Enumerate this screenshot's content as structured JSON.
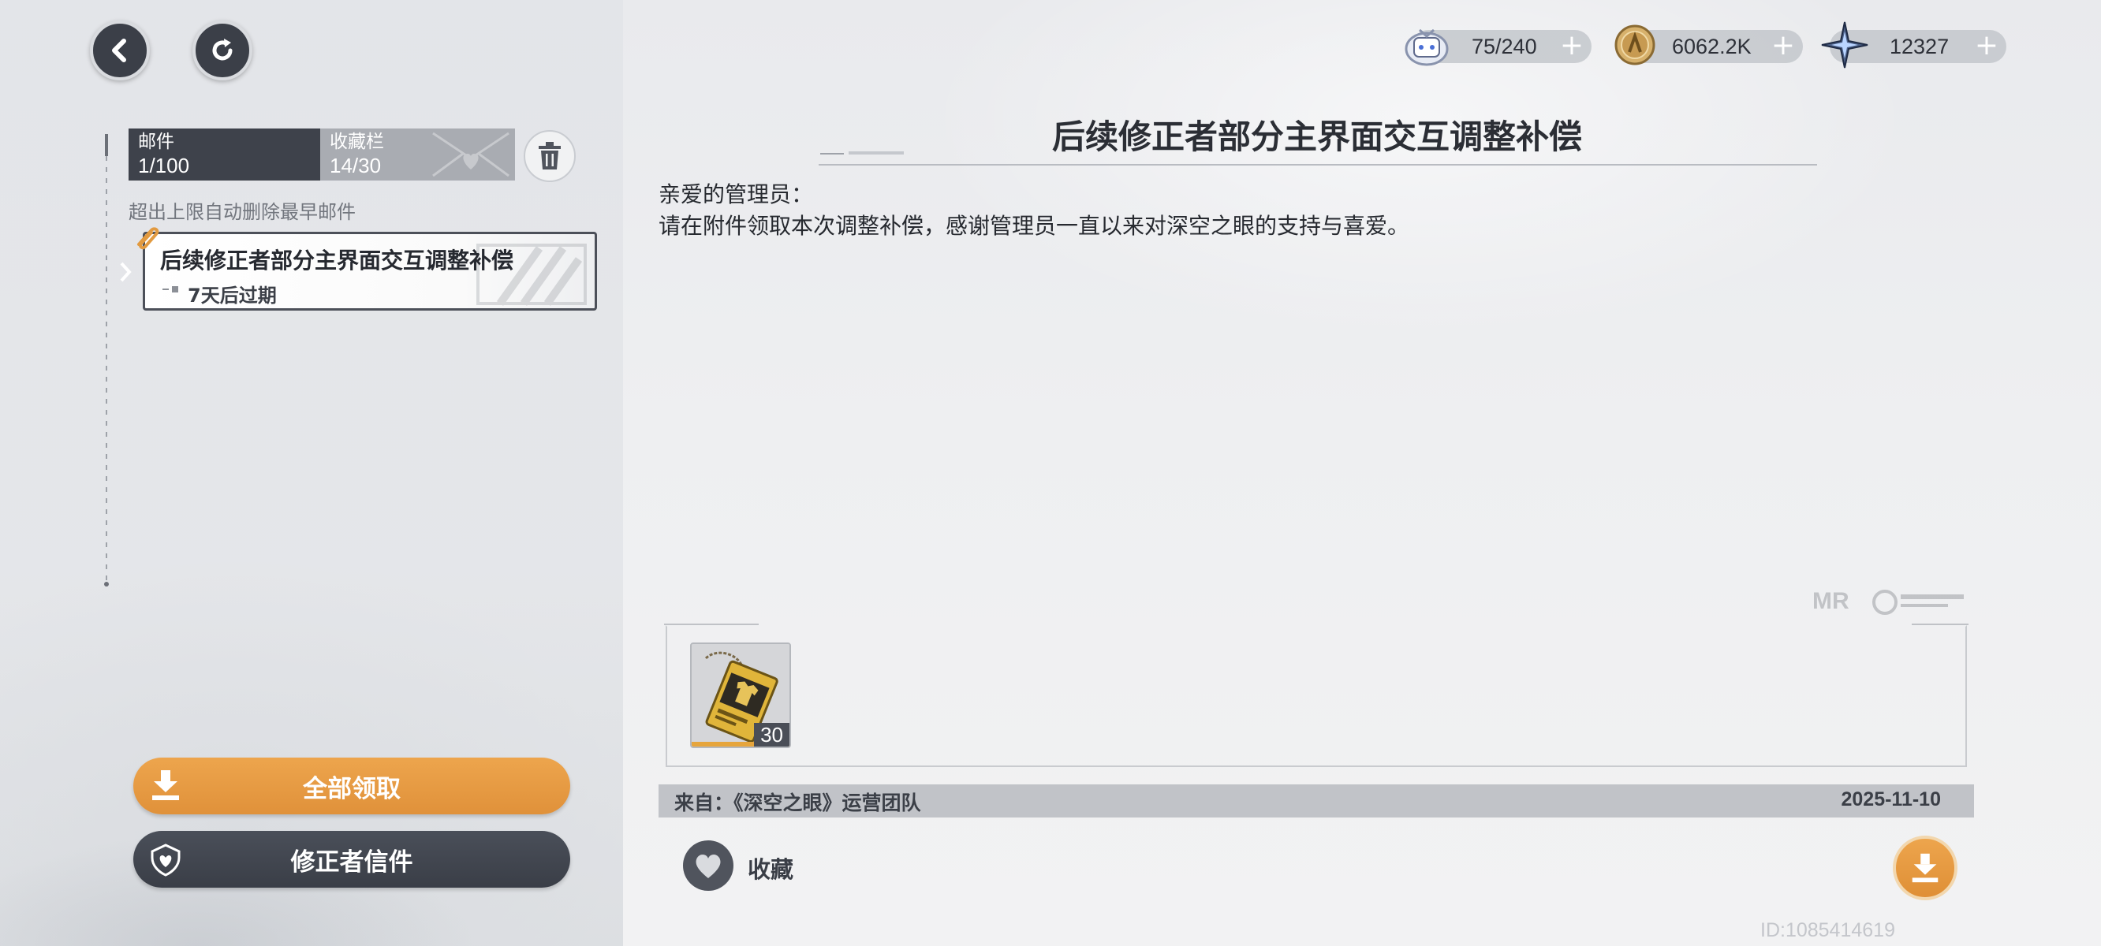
{
  "header": {
    "back_icon": "chevron-left-icon",
    "refresh_icon": "refresh-icon"
  },
  "currencies": [
    {
      "icon": "stamina-pod-icon",
      "value": "75/240",
      "plus": "+"
    },
    {
      "icon": "coin-icon",
      "value": "6062.2K",
      "plus": "+"
    },
    {
      "icon": "star-crystal-icon",
      "value": "12327",
      "plus": "+"
    }
  ],
  "tabs": [
    {
      "label": "邮件",
      "count": "1/100"
    },
    {
      "label": "收藏栏",
      "count": "14/30"
    }
  ],
  "limit_hint": "超出上限自动删除最早邮件",
  "mail_list": [
    {
      "title": "后续修正者部分主界面交互调整补偿",
      "expire": "7天后过期"
    }
  ],
  "buttons": {
    "claim_all": "全部领取",
    "corrector_letters": "修正者信件"
  },
  "mail": {
    "title": "后续修正者部分主界面交互调整补偿",
    "greeting": "亲爱的管理员：",
    "body": "请在附件领取本次调整补偿，感谢管理员一直以来对深空之眼的支持与喜爱。",
    "attachments": [
      {
        "icon": "gold-tag-item-icon",
        "quantity": "30"
      }
    ],
    "sender": "来自：《深空之眼》运营团队",
    "date": "2025-11-10",
    "favorite_label": "收藏"
  },
  "footer": {
    "uid": "ID:1085414619"
  },
  "colors": {
    "accent_orange": "#e89d45",
    "dark_slate": "#3e424b",
    "panel_gray": "#a9acb2"
  }
}
